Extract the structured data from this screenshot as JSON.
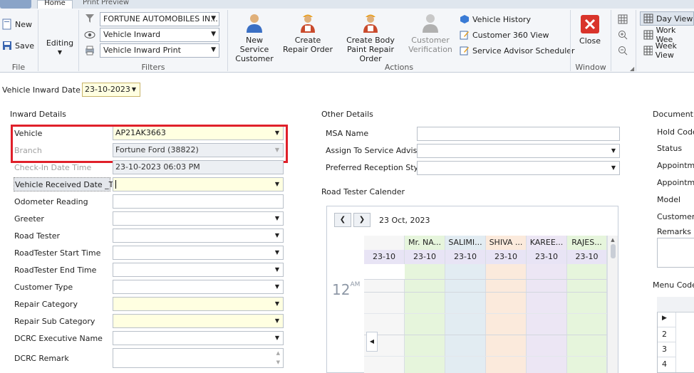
{
  "ribbon": {
    "tabs": [
      "Home",
      "Print Preview"
    ],
    "file": {
      "new_label": "New",
      "save_label": "Save",
      "group_label": "File"
    },
    "editing": {
      "label": "Editing"
    },
    "filters": {
      "dealer": "FORTUNE AUTOMOBILES IN...",
      "view": "Vehicle Inward",
      "print": "Vehicle Inward Print",
      "group_label": "Filters"
    },
    "actions": {
      "new_service_customer": [
        "New Service",
        "Customer"
      ],
      "create_repair_order": [
        "Create",
        "Repair Order"
      ],
      "create_body_paint": [
        "Create Body",
        "Paint Repair Order"
      ],
      "customer_verification": [
        "Customer",
        "Verification"
      ],
      "vehicle_history": "Vehicle History",
      "customer_360": "Customer 360 View",
      "service_advisor_scheduler": "Service Advisor Scheduler",
      "group_label": "Actions"
    },
    "window": {
      "close_label": "Close",
      "group_label": "Window"
    },
    "views": {
      "day": "Day View",
      "work_week": "Work Wee",
      "week": "Week View"
    }
  },
  "inward_date": {
    "label": "Vehicle Inward Date",
    "value": "23-10-2023"
  },
  "inward_details": {
    "title": "Inward Details",
    "fields": [
      {
        "label": "Vehicle",
        "value": "AP21AK3663"
      },
      {
        "label": "Branch",
        "value": "Fortune Ford (38822)"
      },
      {
        "label": "Check-In Date Time",
        "value": "23-10-2023 06:03 PM"
      },
      {
        "label": "Vehicle Received Date _Time",
        "value": ""
      },
      {
        "label": "Odometer Reading",
        "value": ""
      },
      {
        "label": "Greeter",
        "value": ""
      },
      {
        "label": "Road Tester",
        "value": ""
      },
      {
        "label": "RoadTester Start Time",
        "value": ""
      },
      {
        "label": "RoadTester End Time",
        "value": ""
      },
      {
        "label": "Customer Type",
        "value": ""
      },
      {
        "label": "Repair Category",
        "value": ""
      },
      {
        "label": "Repair Sub Category",
        "value": ""
      },
      {
        "label": "DCRC Executive Name",
        "value": ""
      },
      {
        "label": "DCRC Remark",
        "value": ""
      }
    ]
  },
  "other_details": {
    "title": "Other Details",
    "msa_label": "MSA Name",
    "advisor_label": "Assign To Service Advisor",
    "reception_label": "Preferred Reception Style"
  },
  "road_tester": {
    "title": "Road Tester Calender",
    "date": "23 Oct, 2023",
    "hour": "12",
    "hour_suffix": "AM",
    "columns": [
      {
        "name": "Mr. NA...",
        "date": "23-10",
        "color": "#e6f5dc"
      },
      {
        "name": "SALIMI...",
        "date": "23-10",
        "color": "#e2ecf2"
      },
      {
        "name": "SHIVA ...",
        "date": "23-10",
        "color": "#fbeadc"
      },
      {
        "name": "KAREE...",
        "date": "23-10",
        "color": "#ece6f4"
      },
      {
        "name": "RAJES...",
        "date": "23-10",
        "color": "#e6f5dc"
      }
    ],
    "first_date": "23-10"
  },
  "document_details": {
    "title": "Document D",
    "labels": [
      "Hold Code",
      "Status",
      "Appointme",
      "Appointme",
      "Model",
      "Customer",
      "Remarks"
    ]
  },
  "menu_code": {
    "title": "Menu Code",
    "rows": [
      "",
      "2",
      "3",
      "4"
    ]
  }
}
